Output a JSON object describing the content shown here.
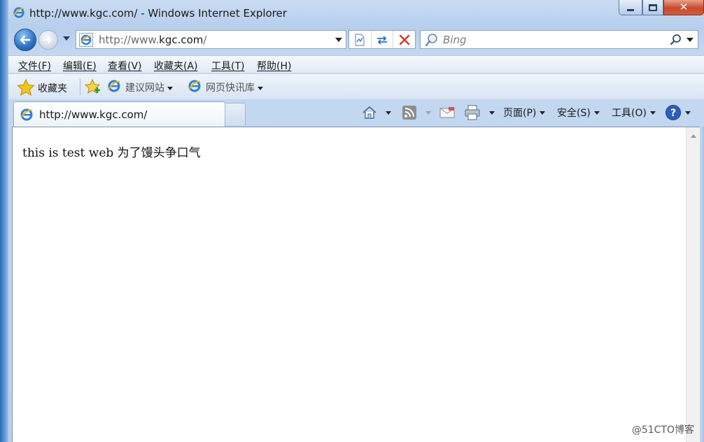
{
  "window": {
    "title": "http://www.kgc.com/ - Windows Internet Explorer"
  },
  "navigation": {
    "address_prefix": "http://www.",
    "address_domain": "kgc.com",
    "address_suffix": "/",
    "search_placeholder": "Bing"
  },
  "menubar": {
    "items": [
      {
        "label": "文件(F)"
      },
      {
        "label": "编辑(E)"
      },
      {
        "label": "查看(V)"
      },
      {
        "label": "收藏夹(A)"
      },
      {
        "label": "工具(T)"
      },
      {
        "label": "帮助(H)"
      }
    ]
  },
  "favorites_bar": {
    "favorites_label": "收藏夹",
    "links": [
      {
        "label": "建议网站"
      },
      {
        "label": "网页快讯库"
      }
    ]
  },
  "tabs": [
    {
      "label": "http://www.kgc.com/"
    }
  ],
  "command_bar": {
    "page_label": "页面(P)",
    "safety_label": "安全(S)",
    "tools_label": "工具(O)"
  },
  "page": {
    "body_text": "this is test web 为了馒头争口气"
  },
  "watermark": "@51CTO博客",
  "icons": {
    "ie": "ie-logo-icon",
    "back": "back-arrow-icon",
    "forward": "forward-arrow-icon",
    "compat": "compatibility-view-icon",
    "refresh": "refresh-icon",
    "stop": "stop-icon",
    "search": "magnifier-icon",
    "home": "home-icon",
    "feeds": "rss-feed-icon",
    "mail": "read-mail-icon",
    "print": "print-icon",
    "help": "help-icon",
    "star": "favorites-star-icon",
    "add_favorite": "add-favorites-icon"
  },
  "colors": {
    "accent_blue": "#2a6fc7",
    "close_red": "#c74a2e"
  }
}
